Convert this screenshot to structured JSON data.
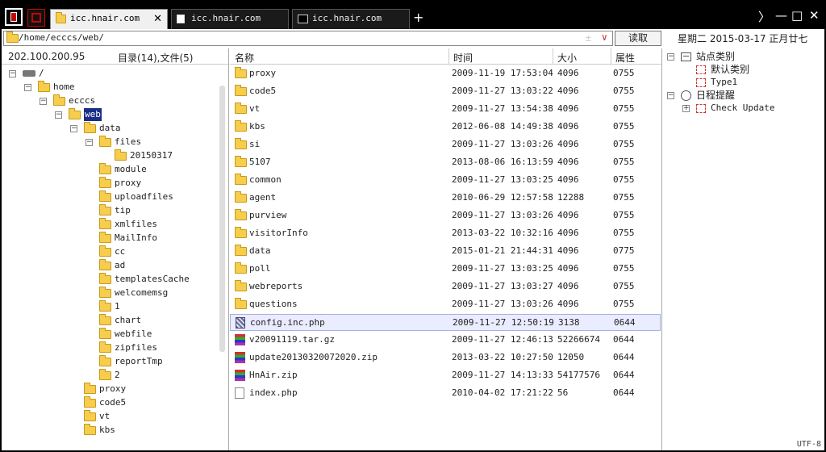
{
  "tabs": [
    {
      "label": "icc.hnair.com",
      "type": "folder",
      "active": true
    },
    {
      "label": "icc.hnair.com",
      "type": "document",
      "active": false
    },
    {
      "label": "icc.hnair.com",
      "type": "terminal",
      "active": false
    }
  ],
  "window": {
    "min": "—",
    "max": "□",
    "close": "✕",
    "nav": "〉"
  },
  "address": {
    "path": "/home/ecccs/web/",
    "read_button": "读取"
  },
  "date_info": "星期二 2015-03-17 正月廿七",
  "left": {
    "ip": "202.100.200.95",
    "counts": "目录(14),文件(5)",
    "tree": [
      {
        "label": "/",
        "type": "drive",
        "depth": 0,
        "exp": "minus"
      },
      {
        "label": "home",
        "depth": 1,
        "exp": "minus"
      },
      {
        "label": "ecccs",
        "depth": 2,
        "exp": "minus"
      },
      {
        "label": "web",
        "depth": 3,
        "exp": "minus",
        "selected": true
      },
      {
        "label": "data",
        "depth": 4,
        "exp": "minus"
      },
      {
        "label": "files",
        "depth": 5,
        "exp": "minus"
      },
      {
        "label": "20150317",
        "depth": 6
      },
      {
        "label": "module",
        "depth": 5
      },
      {
        "label": "proxy",
        "depth": 5
      },
      {
        "label": "uploadfiles",
        "depth": 5
      },
      {
        "label": "tip",
        "depth": 5
      },
      {
        "label": "xmlfiles",
        "depth": 5
      },
      {
        "label": "MailInfo",
        "depth": 5
      },
      {
        "label": "cc",
        "depth": 5
      },
      {
        "label": "ad",
        "depth": 5
      },
      {
        "label": "templatesCache",
        "depth": 5
      },
      {
        "label": "welcomemsg",
        "depth": 5
      },
      {
        "label": "1",
        "depth": 5
      },
      {
        "label": "chart",
        "depth": 5
      },
      {
        "label": "webfile",
        "depth": 5
      },
      {
        "label": "zipfiles",
        "depth": 5
      },
      {
        "label": "reportTmp",
        "depth": 5
      },
      {
        "label": "2",
        "depth": 5
      },
      {
        "label": "proxy",
        "depth": 4
      },
      {
        "label": "code5",
        "depth": 4
      },
      {
        "label": "vt",
        "depth": 4
      },
      {
        "label": "kbs",
        "depth": 4
      }
    ]
  },
  "files": {
    "headers": {
      "name": "名称",
      "time": "时间",
      "size": "大小",
      "attr": "属性"
    },
    "rows": [
      {
        "name": "proxy",
        "time": "2009-11-19 17:53:04",
        "size": "4096",
        "attr": "0755",
        "type": "folder"
      },
      {
        "name": "code5",
        "time": "2009-11-27 13:03:22",
        "size": "4096",
        "attr": "0755",
        "type": "folder"
      },
      {
        "name": "vt",
        "time": "2009-11-27 13:54:38",
        "size": "4096",
        "attr": "0755",
        "type": "folder"
      },
      {
        "name": "kbs",
        "time": "2012-06-08 14:49:38",
        "size": "4096",
        "attr": "0755",
        "type": "folder"
      },
      {
        "name": "si",
        "time": "2009-11-27 13:03:26",
        "size": "4096",
        "attr": "0755",
        "type": "folder"
      },
      {
        "name": "5107",
        "time": "2013-08-06 16:13:59",
        "size": "4096",
        "attr": "0755",
        "type": "folder"
      },
      {
        "name": "common",
        "time": "2009-11-27 13:03:25",
        "size": "4096",
        "attr": "0755",
        "type": "folder"
      },
      {
        "name": "agent",
        "time": "2010-06-29 12:57:58",
        "size": "12288",
        "attr": "0755",
        "type": "folder"
      },
      {
        "name": "purview",
        "time": "2009-11-27 13:03:26",
        "size": "4096",
        "attr": "0755",
        "type": "folder"
      },
      {
        "name": "visitorInfo",
        "time": "2013-03-22 10:32:16",
        "size": "4096",
        "attr": "0755",
        "type": "folder"
      },
      {
        "name": "data",
        "time": "2015-01-21 21:44:31",
        "size": "4096",
        "attr": "0775",
        "type": "folder"
      },
      {
        "name": "poll",
        "time": "2009-11-27 13:03:25",
        "size": "4096",
        "attr": "0755",
        "type": "folder"
      },
      {
        "name": "webreports",
        "time": "2009-11-27 13:03:27",
        "size": "4096",
        "attr": "0755",
        "type": "folder"
      },
      {
        "name": "questions",
        "time": "2009-11-27 13:03:26",
        "size": "4096",
        "attr": "0755",
        "type": "folder"
      },
      {
        "name": "config.inc.php",
        "time": "2009-11-27 12:50:19",
        "size": "3138",
        "attr": "0644",
        "type": "config",
        "highlighted": true
      },
      {
        "name": "v20091119.tar.gz",
        "time": "2009-11-27 12:46:13",
        "size": "52266674",
        "attr": "0644",
        "type": "archive"
      },
      {
        "name": "update20130320072020.zip",
        "time": "2013-03-22 10:27:50",
        "size": "12050",
        "attr": "0644",
        "type": "archive"
      },
      {
        "name": "HnAir.zip",
        "time": "2009-11-27 14:13:33",
        "size": "54177576",
        "attr": "0644",
        "type": "archive"
      },
      {
        "name": "index.php",
        "time": "2010-04-02 17:21:22",
        "size": "56",
        "attr": "0644",
        "type": "document"
      }
    ]
  },
  "right": {
    "items": [
      {
        "label": "站点类别",
        "depth": 0,
        "exp": "minus",
        "icon": "site-icon",
        "cn": true
      },
      {
        "label": "默认类别",
        "depth": 1,
        "icon": "category-icon",
        "cn": true
      },
      {
        "label": "Type1",
        "depth": 1,
        "icon": "category-icon"
      },
      {
        "label": "日程提醒",
        "depth": 0,
        "exp": "minus",
        "icon": "clock-icon",
        "cn": true
      },
      {
        "label": "Check Update",
        "depth": 1,
        "exp": "plus",
        "icon": "category-icon"
      }
    ]
  },
  "status": "UTF-8"
}
